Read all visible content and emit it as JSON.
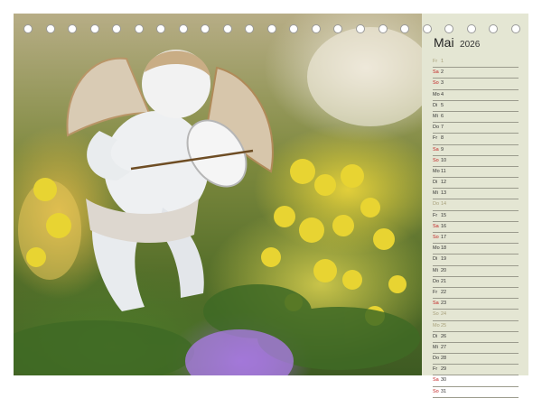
{
  "month": {
    "name": "Mai",
    "year": "2026"
  },
  "days": [
    {
      "day": "Fr",
      "date": "1",
      "type": "hol"
    },
    {
      "day": "Sa",
      "date": "2",
      "type": "sat"
    },
    {
      "day": "So",
      "date": "3",
      "type": "sun"
    },
    {
      "day": "Mo",
      "date": "4",
      "type": "normal"
    },
    {
      "day": "Di",
      "date": "5",
      "type": "normal"
    },
    {
      "day": "Mi",
      "date": "6",
      "type": "normal"
    },
    {
      "day": "Do",
      "date": "7",
      "type": "normal"
    },
    {
      "day": "Fr",
      "date": "8",
      "type": "normal"
    },
    {
      "day": "Sa",
      "date": "9",
      "type": "sat"
    },
    {
      "day": "So",
      "date": "10",
      "type": "sun"
    },
    {
      "day": "Mo",
      "date": "11",
      "type": "normal"
    },
    {
      "day": "Di",
      "date": "12",
      "type": "normal"
    },
    {
      "day": "Mi",
      "date": "13",
      "type": "normal"
    },
    {
      "day": "Do",
      "date": "14",
      "type": "hol"
    },
    {
      "day": "Fr",
      "date": "15",
      "type": "normal"
    },
    {
      "day": "Sa",
      "date": "16",
      "type": "sat"
    },
    {
      "day": "So",
      "date": "17",
      "type": "sun"
    },
    {
      "day": "Mo",
      "date": "18",
      "type": "normal"
    },
    {
      "day": "Di",
      "date": "19",
      "type": "normal"
    },
    {
      "day": "Mi",
      "date": "20",
      "type": "normal"
    },
    {
      "day": "Do",
      "date": "21",
      "type": "normal"
    },
    {
      "day": "Fr",
      "date": "22",
      "type": "normal"
    },
    {
      "day": "Sa",
      "date": "23",
      "type": "sat"
    },
    {
      "day": "So",
      "date": "24",
      "type": "hol"
    },
    {
      "day": "Mo",
      "date": "25",
      "type": "hol"
    },
    {
      "day": "Di",
      "date": "26",
      "type": "normal"
    },
    {
      "day": "Mi",
      "date": "27",
      "type": "normal"
    },
    {
      "day": "Do",
      "date": "28",
      "type": "normal"
    },
    {
      "day": "Fr",
      "date": "29",
      "type": "normal"
    },
    {
      "day": "Sa",
      "date": "30",
      "type": "sat"
    },
    {
      "day": "So",
      "date": "31",
      "type": "sun"
    }
  ],
  "colors": {
    "panel_background": "#e4e6d3",
    "weekend_text": "#c22323",
    "holiday_text": "#a8a07a",
    "rule_line": "#9b9b8d"
  },
  "photo_subject": "white cherub figurine playing violin among yellow sedum flowers"
}
